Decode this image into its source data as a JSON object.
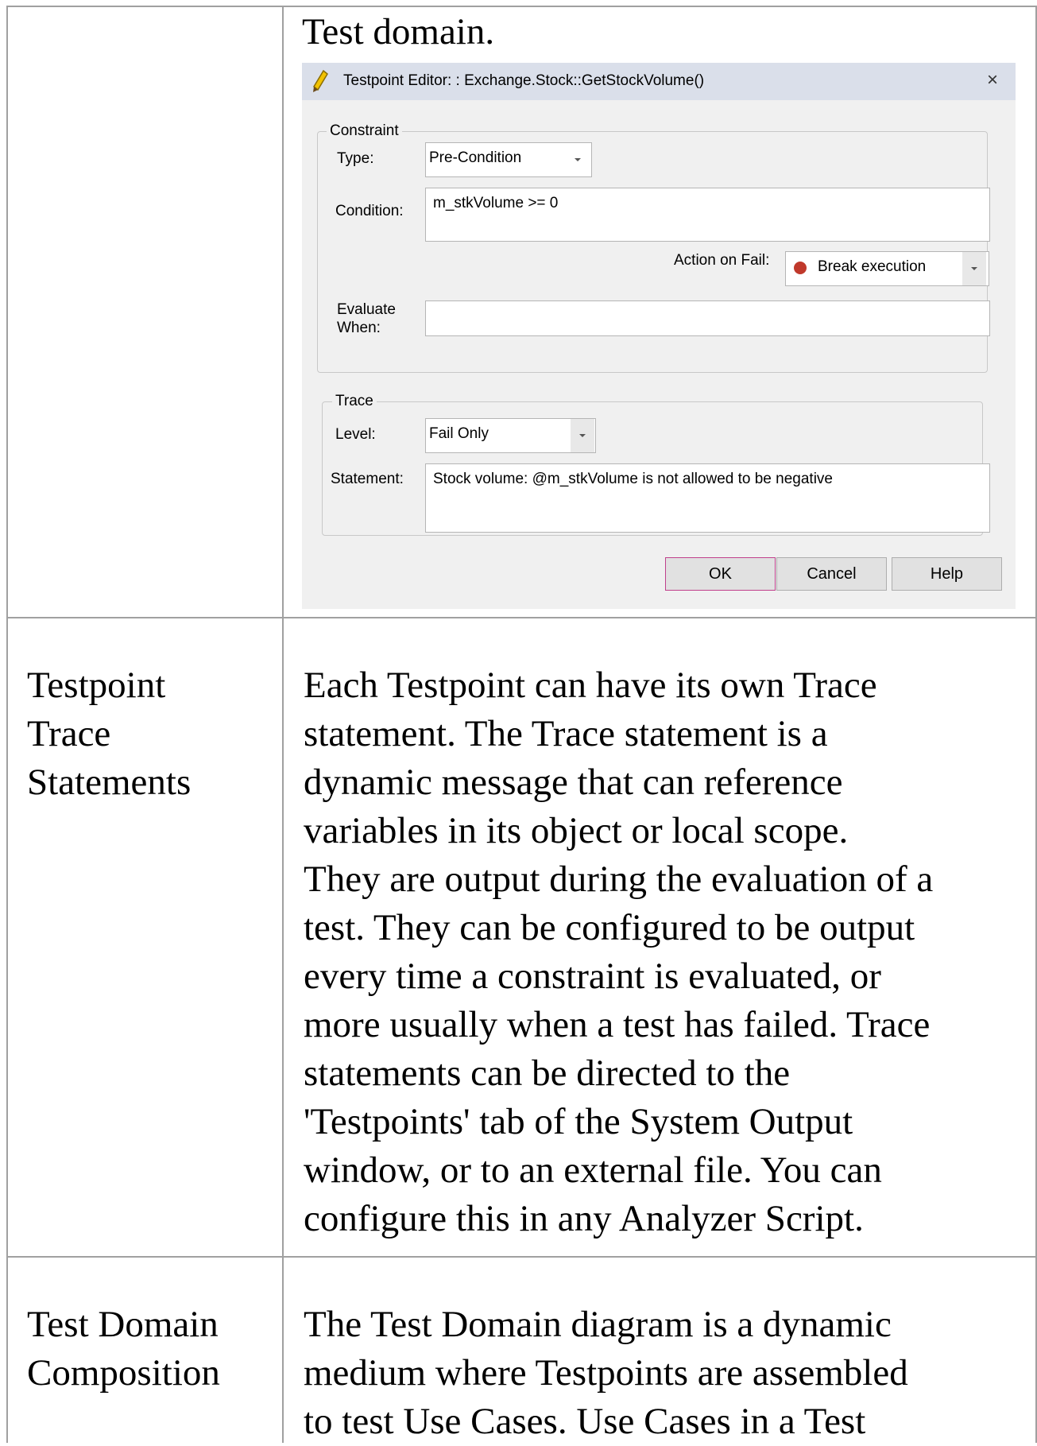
{
  "row1": {
    "desc_tail": "Test domain."
  },
  "dialog": {
    "title": "Testpoint Editor: : Exchange.Stock::GetStockVolume()",
    "close": "×",
    "constraint": {
      "legend": "Constraint",
      "type_label": "Type:",
      "type_value": "Pre-Condition",
      "condition_label": "Condition:",
      "condition_value": "m_stkVolume >= 0",
      "action_label": "Action on Fail:",
      "action_value": "Break execution",
      "action_icon_color": "#c0392b",
      "evaluate_label_1": "Evaluate",
      "evaluate_label_2": "When:",
      "evaluate_value": ""
    },
    "trace": {
      "legend": "Trace",
      "level_label": "Level:",
      "level_value": "Fail Only",
      "statement_label": "Statement:",
      "statement_value": "Stock volume: @m_stkVolume is not allowed to be negative"
    },
    "buttons": {
      "ok": "OK",
      "cancel": "Cancel",
      "help": "Help"
    }
  },
  "row2": {
    "term_lines": [
      "Testpoint",
      "Trace",
      "Statements"
    ],
    "desc_lines": [
      "Each Testpoint can have its own Trace",
      "statement. The Trace statement is a",
      "dynamic message that can reference",
      "variables in its object or local scope.",
      "They are output during the evaluation of a",
      "test. They can be configured to be output",
      "every time a constraint is evaluated, or",
      "more usually when a test has failed. Trace",
      "statements can be directed to the",
      "'Testpoints' tab of the System Output",
      "window, or to an external file. You can",
      "configure this in any Analyzer Script."
    ]
  },
  "row3": {
    "term_lines": [
      "Test Domain",
      "Composition"
    ],
    "desc_lines": [
      "The Test Domain diagram is a dynamic",
      "medium where Testpoints are assembled",
      "to test Use Cases. Use Cases in a Test"
    ]
  }
}
